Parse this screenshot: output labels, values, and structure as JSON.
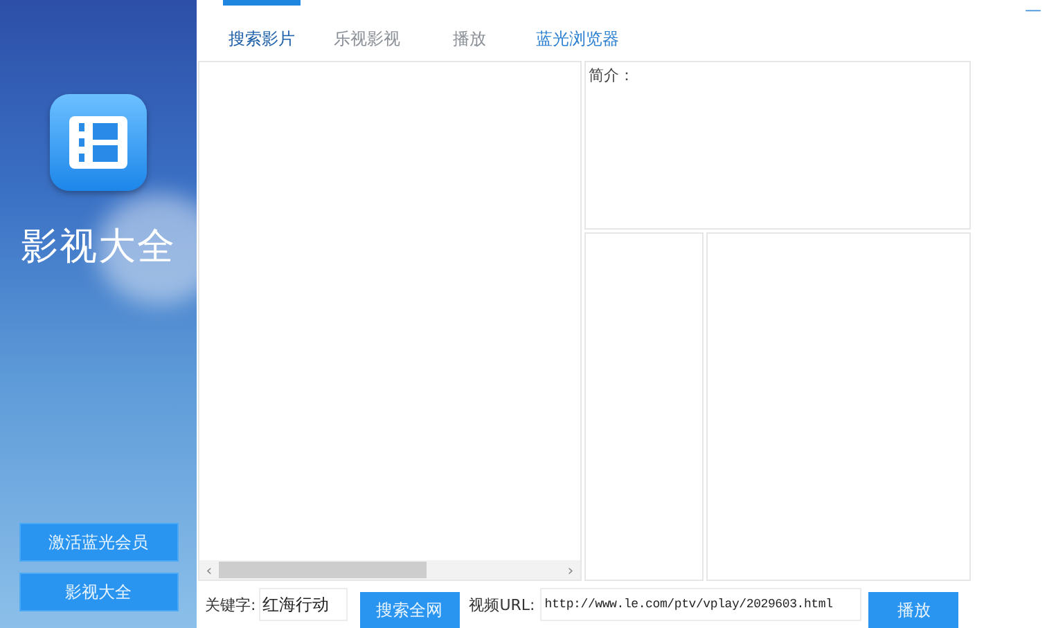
{
  "sidebar": {
    "app_title": "影视大全",
    "buttons": [
      "激活蓝光会员",
      "影视大全"
    ]
  },
  "window": {
    "minimize": "—"
  },
  "tabs": [
    {
      "label": "搜索影片",
      "selected": true,
      "highlighted": false
    },
    {
      "label": "乐视影视",
      "selected": false,
      "highlighted": false
    },
    {
      "label": "播放",
      "selected": false,
      "highlighted": false
    },
    {
      "label": "蓝光浏览器",
      "selected": false,
      "highlighted": true
    }
  ],
  "scrollbar": {
    "left_arrow": "‹",
    "right_arrow": "›"
  },
  "intro": {
    "label": "简介："
  },
  "search_bar": {
    "keyword_label": "关键字:",
    "keyword_value": "红海行动",
    "search_button": "搜索全网",
    "url_label": "视频URL:",
    "url_value": "http://www.le.com/ptv/vplay/2029603.html",
    "play_button": "播放"
  }
}
